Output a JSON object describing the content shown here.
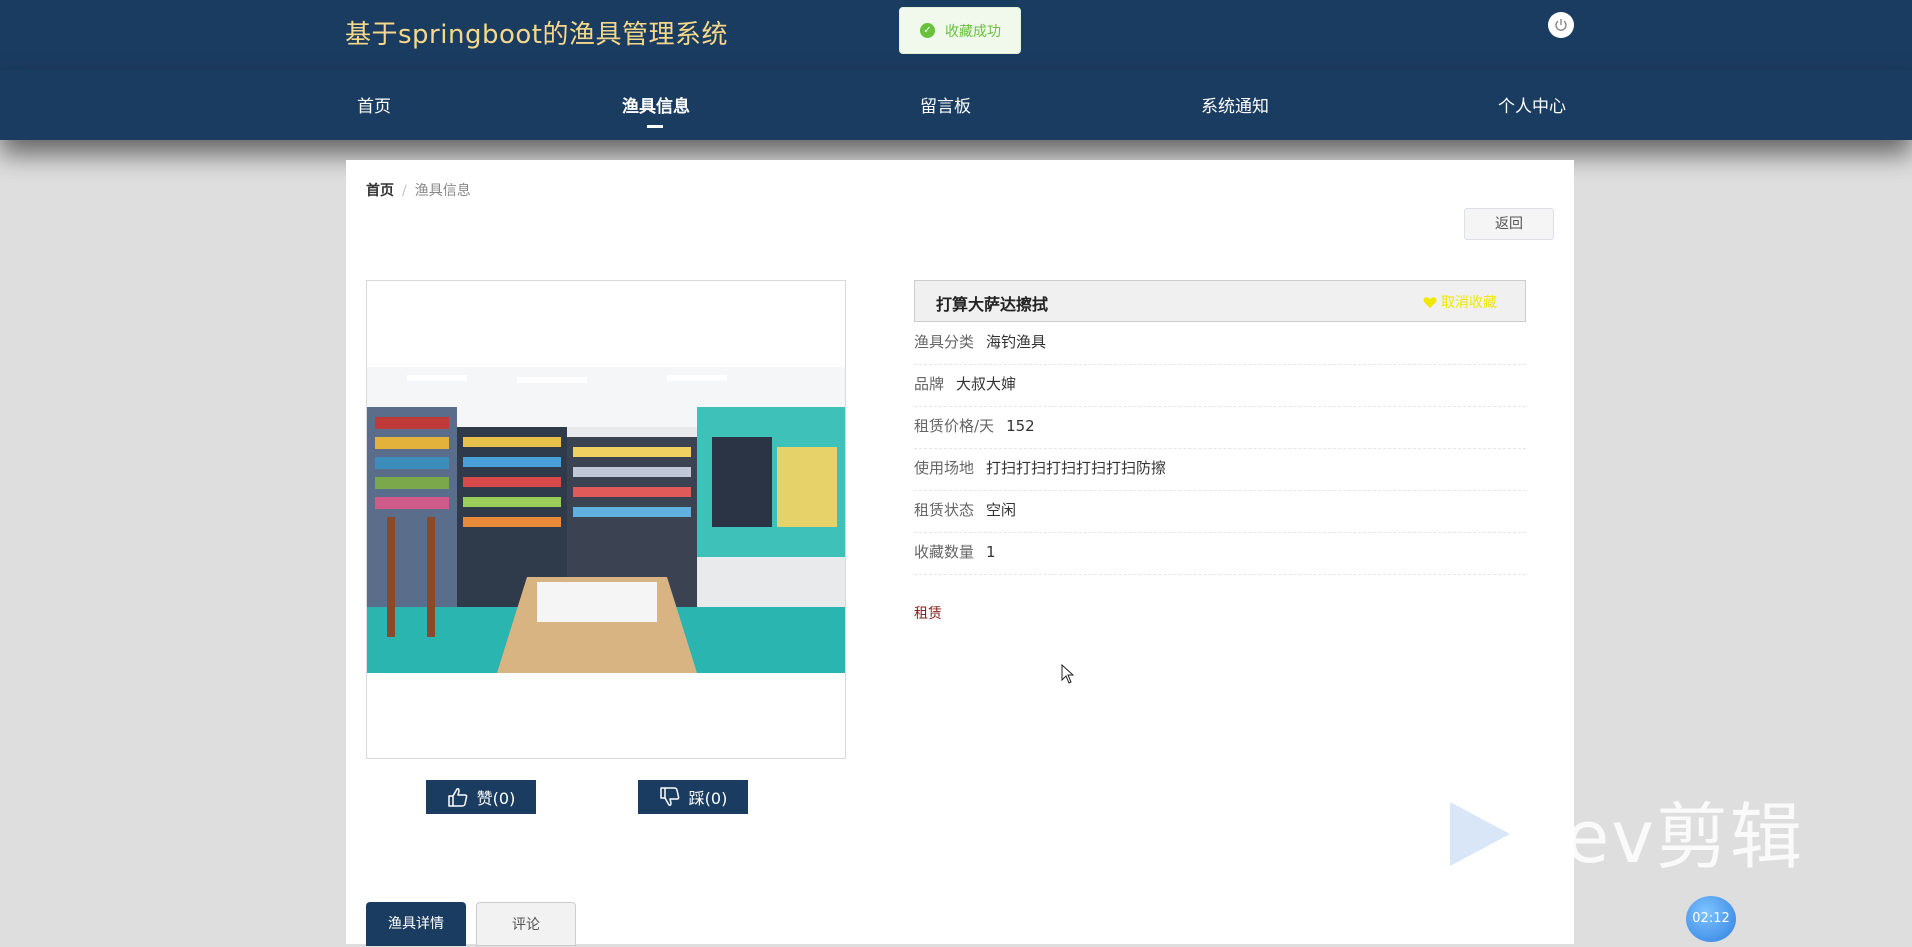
{
  "header": {
    "site_title": "基于springboot的渔具管理系统"
  },
  "toast": {
    "message": "收藏成功"
  },
  "nav": [
    {
      "label": "首页",
      "active": false
    },
    {
      "label": "渔具信息",
      "active": true
    },
    {
      "label": "留言板",
      "active": false
    },
    {
      "label": "系统通知",
      "active": false
    },
    {
      "label": "个人中心",
      "active": false
    }
  ],
  "breadcrumb": {
    "home": "首页",
    "separator": "/",
    "current": "渔具信息"
  },
  "back_label": "返回",
  "product": {
    "name": "打算大萨达擦拭",
    "favorite_label": "取消收藏",
    "fields": [
      {
        "label": "渔具分类",
        "value": "海钓渔具"
      },
      {
        "label": "品牌",
        "value": "大叔大婶"
      },
      {
        "label": "租赁价格/天",
        "value": "152"
      },
      {
        "label": "使用场地",
        "value": "打扫打扫打扫打扫打扫防擦"
      },
      {
        "label": "租赁状态",
        "value": "空闲"
      },
      {
        "label": "收藏数量",
        "value": "1"
      }
    ],
    "rent_label": "租赁"
  },
  "votes": {
    "like_label": "赞(0)",
    "dislike_label": "踩(0)"
  },
  "tabs": [
    {
      "label": "渔具详情"
    },
    {
      "label": "评论"
    }
  ],
  "watermark": {
    "text": "ev剪辑",
    "timer": "02:12"
  },
  "colors": {
    "nav_bg": "#1b3c61",
    "title": "#f5d889",
    "success": "#67c23a",
    "favorite": "#f0e800",
    "rent": "#8b1a1a"
  }
}
